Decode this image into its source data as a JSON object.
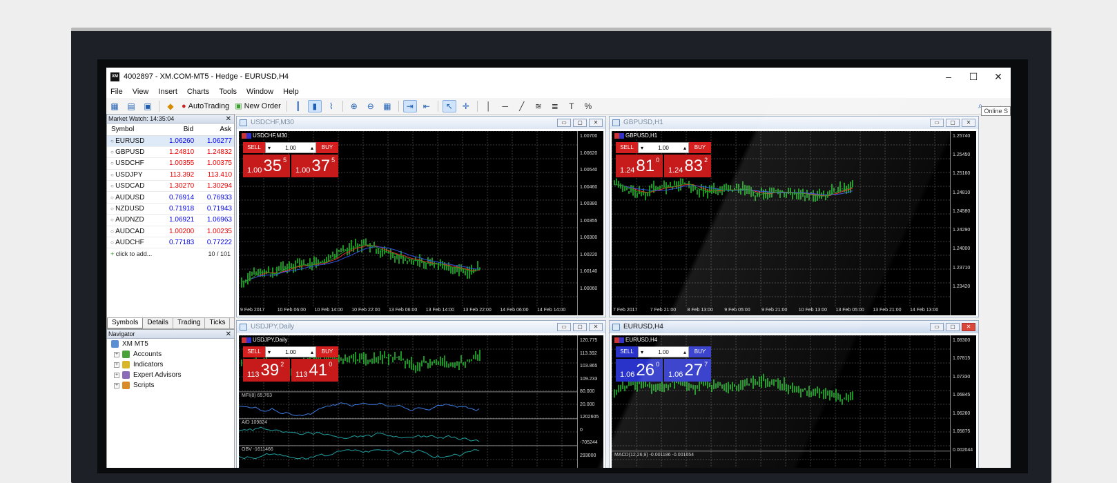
{
  "window": {
    "title": "4002897 - XM.COM-MT5 - Hedge - EURUSD,H4",
    "logo": "XM"
  },
  "menu": [
    "File",
    "View",
    "Insert",
    "Charts",
    "Tools",
    "Window",
    "Help"
  ],
  "toolbar": {
    "autotrading": "AutoTrading",
    "new_order": "New Order",
    "tooltip": "Online S"
  },
  "market_watch": {
    "title": "Market Watch: 14:35:04",
    "headers": [
      "Symbol",
      "Bid",
      "Ask"
    ],
    "rows": [
      {
        "symbol": "EURUSD",
        "bid": "1.06260",
        "ask": "1.06277",
        "color": "blue"
      },
      {
        "symbol": "GBPUSD",
        "bid": "1.24810",
        "ask": "1.24832",
        "color": "red"
      },
      {
        "symbol": "USDCHF",
        "bid": "1.00355",
        "ask": "1.00375",
        "color": "red"
      },
      {
        "symbol": "USDJPY",
        "bid": "113.392",
        "ask": "113.410",
        "color": "red"
      },
      {
        "symbol": "USDCAD",
        "bid": "1.30270",
        "ask": "1.30294",
        "color": "red"
      },
      {
        "symbol": "AUDUSD",
        "bid": "0.76914",
        "ask": "0.76933",
        "color": "blue"
      },
      {
        "symbol": "NZDUSD",
        "bid": "0.71918",
        "ask": "0.71943",
        "color": "blue"
      },
      {
        "symbol": "AUDNZD",
        "bid": "1.06921",
        "ask": "1.06963",
        "color": "blue"
      },
      {
        "symbol": "AUDCAD",
        "bid": "1.00200",
        "ask": "1.00235",
        "color": "red"
      },
      {
        "symbol": "AUDCHF",
        "bid": "0.77183",
        "ask": "0.77222",
        "color": "blue"
      }
    ],
    "add": "click to add...",
    "count": "10 / 101",
    "tabs": [
      "Symbols",
      "Details",
      "Trading",
      "Ticks"
    ]
  },
  "navigator": {
    "title": "Navigator",
    "items": [
      "XM MT5",
      "Accounts",
      "Indicators",
      "Expert Advisors",
      "Scripts"
    ]
  },
  "charts": [
    {
      "window_title": "USDCHF,M30",
      "symbol_label": "USDCHF,M30",
      "active": false,
      "sell": "SELL",
      "buy": "BUY",
      "volume": "1.00",
      "sell_price": {
        "prefix": "1.00",
        "big": "35",
        "sup": "5"
      },
      "buy_price": {
        "prefix": "1.00",
        "big": "37",
        "sup": "5"
      },
      "trade_color": "red",
      "yticks": [
        "1.00700",
        "1.00620",
        "1.00540",
        "1.00460",
        "1.00380",
        "1.00355",
        "1.00300",
        "1.00220",
        "1.00140",
        "1.00060"
      ],
      "xticks": [
        "9 Feb 2017",
        "10 Feb 06:00",
        "10 Feb 14:00",
        "10 Feb 22:00",
        "13 Feb 06:00",
        "13 Feb 14:00",
        "13 Feb 22:00",
        "14 Feb 06:00",
        "14 Feb 14:00"
      ]
    },
    {
      "window_title": "GBPUSD,H1",
      "symbol_label": "GBPUSD,H1",
      "active": false,
      "sell": "SELL",
      "buy": "BUY",
      "volume": "1.00",
      "sell_price": {
        "prefix": "1.24",
        "big": "81",
        "sup": "0"
      },
      "buy_price": {
        "prefix": "1.24",
        "big": "83",
        "sup": "2"
      },
      "trade_color": "red",
      "yticks": [
        "1.25740",
        "1.25450",
        "1.25160",
        "1.24810",
        "1.24580",
        "1.24290",
        "1.24000",
        "1.23710",
        "1.23420"
      ],
      "xticks": [
        "7 Feb 2017",
        "7 Feb 21:00",
        "8 Feb 13:00",
        "9 Feb 05:00",
        "9 Feb 21:00",
        "10 Feb 13:00",
        "13 Feb 05:00",
        "13 Feb 21:00",
        "14 Feb 13:00"
      ]
    },
    {
      "window_title": "USDJPY,Daily",
      "symbol_label": "USDJPY,Daily",
      "active": false,
      "sell": "SELL",
      "buy": "BUY",
      "volume": "1.00",
      "sell_price": {
        "prefix": "113",
        "big": "39",
        "sup": "2"
      },
      "buy_price": {
        "prefix": "113",
        "big": "41",
        "sup": "0"
      },
      "trade_color": "red",
      "yticks": [
        "120.775",
        "113.392",
        "103.865",
        "109.233",
        "80.000",
        "20.000",
        "1202605",
        "0",
        "-705244",
        "293000"
      ],
      "sub_labels": [
        "MFI(8) 65.763",
        "A/D 109824",
        "OBV -1611466"
      ]
    },
    {
      "window_title": "EURUSD,H4",
      "symbol_label": "EURUSD,H4",
      "active": true,
      "sell": "SELL",
      "buy": "BUY",
      "volume": "1.00",
      "sell_price": {
        "prefix": "1.06",
        "big": "26",
        "sup": "0"
      },
      "buy_price": {
        "prefix": "1.06",
        "big": "27",
        "sup": "7"
      },
      "trade_color": "blue",
      "yticks": [
        "1.08300",
        "1.07815",
        "1.07330",
        "1.06845",
        "1.06260",
        "1.05875",
        "0.002044"
      ],
      "sub_labels": [
        "MACD(12,26,9) -0.001186 -0.001654"
      ]
    }
  ]
}
